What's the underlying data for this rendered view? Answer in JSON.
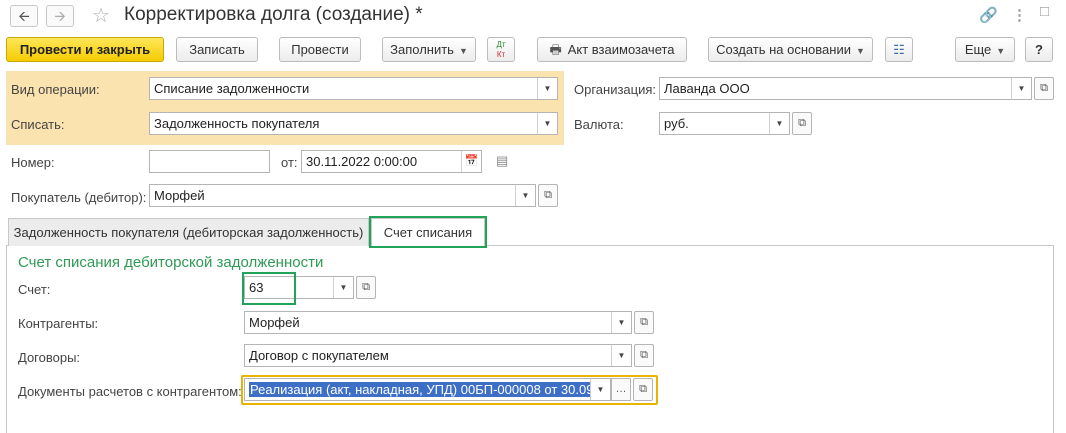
{
  "window": {
    "title": "Корректировка долга (создание) *",
    "nav_back_icon": "arrow-left-icon",
    "nav_forward_icon": "arrow-right-icon"
  },
  "toolbar": {
    "post_close": "Провести и закрыть",
    "save": "Записать",
    "post": "Провести",
    "fill": "Заполнить",
    "dtkt_top": "Дт",
    "dtkt_bottom": "Кт",
    "act": "Акт взаимозачета",
    "create_based": "Создать на основании",
    "more": "Еще",
    "help": "?"
  },
  "header": {
    "operation_label": "Вид операции:",
    "operation_value": "Списание задолженности",
    "writeoff_label": "Списать:",
    "writeoff_value": "Задолженность покупателя",
    "org_label": "Организация:",
    "org_value": "Лаванда ООО",
    "currency_label": "Валюта:",
    "currency_value": "руб.",
    "number_label": "Номер:",
    "number_value": "",
    "date_label": "от:",
    "date_value": "30.11.2022  0:00:00",
    "buyer_label": "Покупатель (дебитор):",
    "buyer_value": "Морфей"
  },
  "tabs": [
    {
      "label": "Задолженность покупателя (дебиторская задолженность)"
    },
    {
      "label": "Счет списания"
    }
  ],
  "writeoff_tab": {
    "section_title": "Счет списания дебиторской задолженности",
    "account_label": "Счет:",
    "account_value": "63",
    "counterparty_label": "Контрагенты:",
    "counterparty_value": "Морфей",
    "contract_label": "Договоры:",
    "contract_value": "Договор с покупателем",
    "docs_label": "Документы расчетов с контрагентом:",
    "docs_value": "Реализация (акт, накладная, УПД) 00БП-000008 от 30.09"
  },
  "colors": {
    "primary_button": "#f5cc00",
    "operation_block_bg": "#fbe3b0",
    "section_title": "#2e9a55",
    "highlight_box": "#22a35a",
    "selection": "#3e6fc6",
    "focus_border": "#e8b400"
  }
}
